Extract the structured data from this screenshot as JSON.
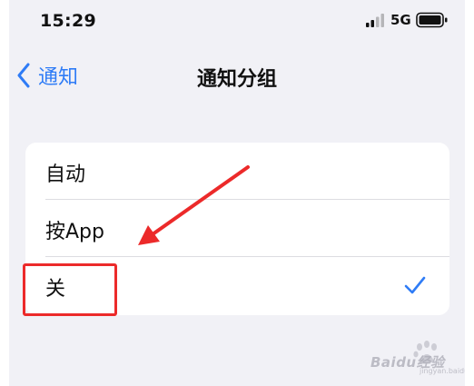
{
  "status_bar": {
    "time": "15:29",
    "network": "5G"
  },
  "nav": {
    "back_label": "通知",
    "title": "通知分组"
  },
  "options": [
    {
      "label": "自动",
      "selected": false
    },
    {
      "label": "按App",
      "selected": false
    },
    {
      "label": "关",
      "selected": true
    }
  ],
  "annotations": {
    "color": "#ec2a2a",
    "highlighted_option": "关"
  },
  "watermark": {
    "brand": "Baidu",
    "suffix": "经验",
    "url": "jingyan.baidu.com"
  },
  "colors": {
    "accent": "#2f7cf6",
    "background": "#f1f1f6",
    "card": "#ffffff"
  }
}
